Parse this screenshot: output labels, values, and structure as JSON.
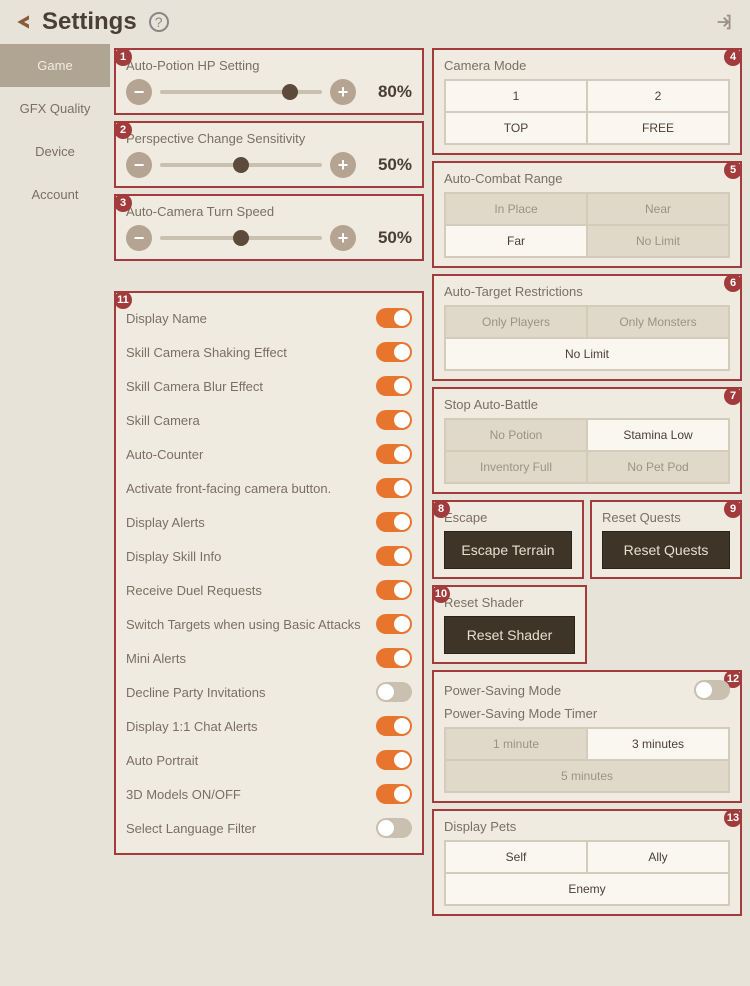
{
  "header": {
    "title": "Settings"
  },
  "tabs": [
    "Game",
    "GFX Quality",
    "Device",
    "Account"
  ],
  "activeTab": 0,
  "sliders": [
    {
      "num": "1",
      "title": "Auto-Potion HP Setting",
      "value": "80%",
      "pct": 80
    },
    {
      "num": "2",
      "title": "Perspective Change Sensitivity",
      "value": "50%",
      "pct": 50
    },
    {
      "num": "3",
      "title": "Auto-Camera Turn Speed",
      "value": "50%",
      "pct": 50
    }
  ],
  "toggles": {
    "num": "11",
    "items": [
      {
        "label": "Display Name",
        "on": true
      },
      {
        "label": "Skill Camera Shaking Effect",
        "on": true
      },
      {
        "label": "Skill Camera Blur Effect",
        "on": true
      },
      {
        "label": "Skill Camera",
        "on": true
      },
      {
        "label": "Auto-Counter",
        "on": true
      },
      {
        "label": "Activate front-facing camera button.",
        "on": true
      },
      {
        "label": "Display Alerts",
        "on": true
      },
      {
        "label": "Display Skill Info",
        "on": true
      },
      {
        "label": "Receive Duel Requests",
        "on": true
      },
      {
        "label": "Switch Targets when using Basic Attacks",
        "on": true
      },
      {
        "label": "Mini Alerts",
        "on": true
      },
      {
        "label": "Decline Party Invitations",
        "on": false
      },
      {
        "label": "Display 1:1 Chat Alerts",
        "on": true
      },
      {
        "label": "Auto Portrait",
        "on": true
      },
      {
        "label": "3D Models ON/OFF",
        "on": true
      },
      {
        "label": "Select Language Filter",
        "on": false
      }
    ]
  },
  "right": {
    "camera": {
      "num": "4",
      "title": "Camera Mode",
      "opts": [
        "1",
        "2",
        "TOP",
        "FREE"
      ],
      "sel": [
        0,
        1,
        2,
        3
      ]
    },
    "combat": {
      "num": "5",
      "title": "Auto-Combat Range",
      "opts": [
        "In Place",
        "Near",
        "Far",
        "No Limit"
      ],
      "sel": [
        2
      ]
    },
    "target": {
      "num": "6",
      "title": "Auto-Target Restrictions",
      "opts": [
        "Only Players",
        "Only Monsters",
        "No Limit"
      ],
      "sel": [
        2
      ]
    },
    "stop": {
      "num": "7",
      "title": "Stop Auto-Battle",
      "opts": [
        "No Potion",
        "Stamina Low",
        "Inventory Full",
        "No Pet Pod"
      ],
      "sel": [
        1
      ]
    },
    "escape": {
      "num": "8",
      "title": "Escape",
      "btn": "Escape Terrain"
    },
    "resetq": {
      "num": "9",
      "title": "Reset Quests",
      "btn": "Reset Quests"
    },
    "shader": {
      "num": "10",
      "title": "Reset Shader",
      "btn": "Reset Shader"
    },
    "power": {
      "num": "12",
      "title": "Power-Saving Mode",
      "subtitle": "Power-Saving Mode Timer",
      "on": false,
      "opts": [
        "1 minute",
        "3 minutes",
        "5 minutes"
      ],
      "sel": [
        1
      ]
    },
    "pets": {
      "num": "13",
      "title": "Display Pets",
      "opts": [
        "Self",
        "Ally",
        "Enemy"
      ],
      "sel": [
        0,
        1,
        2
      ]
    }
  }
}
